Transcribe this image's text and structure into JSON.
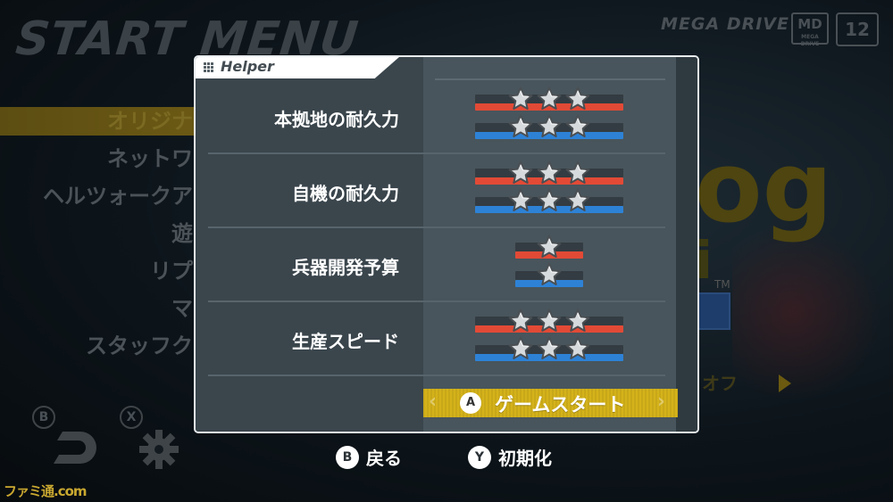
{
  "background": {
    "title": "START MENU",
    "brand": "MEGA DRIVE",
    "md_logo": "MD",
    "md_logo_sub": "MEGA DRIVE",
    "menu_items": [
      "オリジナ",
      "ネットワ",
      "ヘルツォークア",
      "遊",
      "リプ",
      "マ",
      "スタッフク"
    ],
    "art_text": "og",
    "art_sub": "i",
    "trademark": "TM",
    "faded_label": "オフ",
    "buttons": {
      "b": "B",
      "x": "X"
    }
  },
  "dialog": {
    "title": "Helper",
    "rows": [
      {
        "label": "本拠地の耐久力",
        "red_stars": 3,
        "blue_stars": 3
      },
      {
        "label": "自機の耐久力",
        "red_stars": 3,
        "blue_stars": 3
      },
      {
        "label": "兵器開発予算",
        "red_stars": 1,
        "blue_stars": 1
      },
      {
        "label": "生産スピード",
        "red_stars": 3,
        "blue_stars": 3
      }
    ],
    "start": {
      "button": "A",
      "label": "ゲームスタート"
    }
  },
  "footer": {
    "back": {
      "button": "B",
      "label": "戻る"
    },
    "reset": {
      "button": "Y",
      "label": "初期化"
    }
  },
  "watermark": "ファミ通.com",
  "colors": {
    "player_red": "#e24a36",
    "player_blue": "#2e82d6",
    "start_bar": "#d4b21a"
  }
}
